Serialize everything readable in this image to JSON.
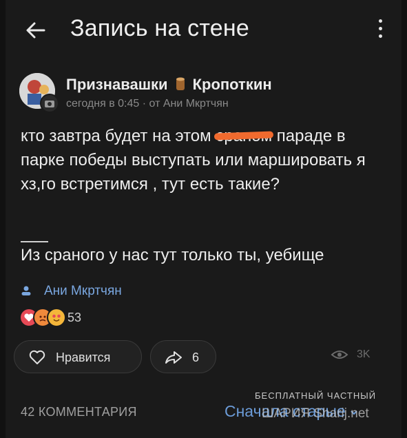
{
  "header": {
    "title": "Запись на стене"
  },
  "post": {
    "author": "Признавашки",
    "author_suffix": "Кропоткин",
    "meta": "сегодня в 0:45 · от Ани Мкртчян",
    "text_before": "кто завтра будет на этом ",
    "text_censored": "сраном",
    "text_after": " параде в парке победы выступать или маршировать я хз,го встретимся , тут есть такие?",
    "reply_text": "Из сраного у нас тут только ты, уебище",
    "signature": "Ани Мкртчян",
    "reactions_count": "53"
  },
  "actions": {
    "like_label": "Нравится",
    "share_count": "6",
    "views": "3K"
  },
  "comments": {
    "count_label": "42 КОММЕНТАРИЯ",
    "sort_label": "Сначала старые"
  },
  "watermark": {
    "line1": "БЕСПЛАТНЫЙ ЧАСТНЫЙ",
    "line2": "ШАРИЯ Sharij.net"
  },
  "colors": {
    "accent": "#7aa7e0",
    "censor": "#f06a2e",
    "background": "#1a1a1a"
  }
}
